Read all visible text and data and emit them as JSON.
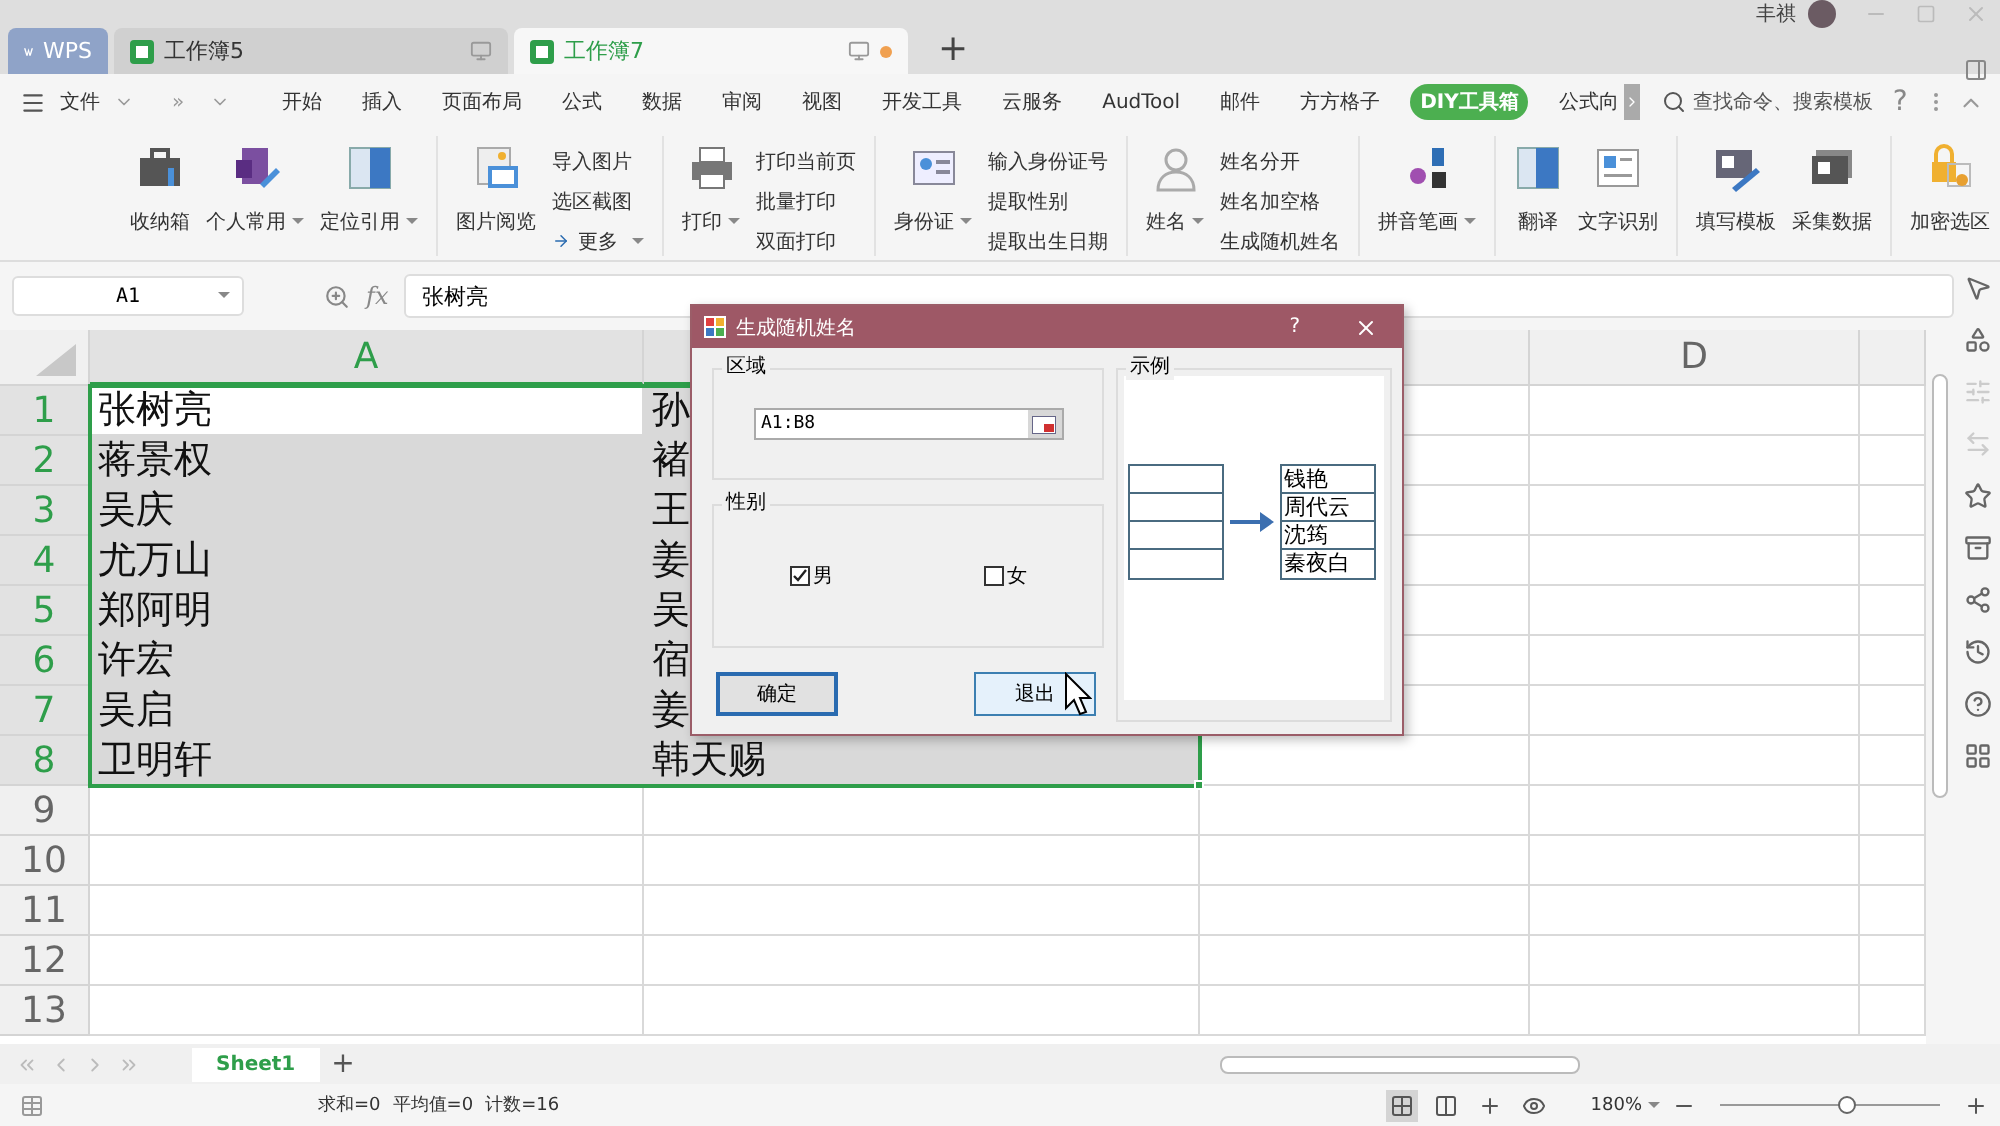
{
  "window": {
    "tabs": [
      {
        "label": "WPS",
        "kind": "home",
        "selected": false,
        "unsaved": false
      },
      {
        "label": "工作簿5",
        "kind": "doc",
        "selected": false,
        "unsaved": false
      },
      {
        "label": "工作簿7",
        "kind": "doc",
        "selected": true,
        "unsaved": true
      }
    ],
    "new_tab": "+",
    "user": "丰祺"
  },
  "menu": {
    "file": "文件",
    "more": "»",
    "tabs": [
      {
        "label": "开始",
        "selected": false
      },
      {
        "label": "插入",
        "selected": false
      },
      {
        "label": "页面布局",
        "selected": false
      },
      {
        "label": "公式",
        "selected": false
      },
      {
        "label": "数据",
        "selected": false
      },
      {
        "label": "审阅",
        "selected": false
      },
      {
        "label": "视图",
        "selected": false
      },
      {
        "label": "开发工具",
        "selected": false
      },
      {
        "label": "云服务",
        "selected": false
      },
      {
        "label": "AudTool",
        "selected": false
      },
      {
        "label": "邮件",
        "selected": false
      },
      {
        "label": "方方格子",
        "selected": false
      },
      {
        "label": "DIY工具箱",
        "selected": true
      },
      {
        "label": "公式向",
        "selected": false
      }
    ],
    "search": {
      "placeholder": "查找命令、搜索模板"
    },
    "help": "?"
  },
  "ribbon": [
    {
      "items": [
        {
          "kind": "large",
          "label": "收纳箱",
          "dropdown": false
        },
        {
          "kind": "large",
          "label": "个人常用",
          "dropdown": true
        },
        {
          "kind": "large",
          "label": "定位引用",
          "dropdown": true
        }
      ]
    },
    {
      "items": [
        {
          "kind": "large",
          "label": "图片阅览",
          "dropdown": false
        },
        {
          "kind": "stack",
          "items": [
            {
              "label": "导入图片",
              "dropdown": false,
              "arrow": false
            },
            {
              "label": "选区截图",
              "dropdown": false,
              "arrow": false
            },
            {
              "label": "更多",
              "dropdown": true,
              "arrow": true
            }
          ]
        }
      ]
    },
    {
      "items": [
        {
          "kind": "large",
          "label": "打印",
          "dropdown": true
        },
        {
          "kind": "stack",
          "items": [
            {
              "label": "打印当前页",
              "dropdown": false,
              "arrow": false
            },
            {
              "label": "批量打印",
              "dropdown": false,
              "arrow": false
            },
            {
              "label": "双面打印",
              "dropdown": false,
              "arrow": false
            }
          ]
        }
      ]
    },
    {
      "items": [
        {
          "kind": "large",
          "label": "身份证",
          "dropdown": true
        },
        {
          "kind": "stack",
          "items": [
            {
              "label": "输入身份证号",
              "dropdown": false,
              "arrow": false
            },
            {
              "label": "提取性别",
              "dropdown": false,
              "arrow": false
            },
            {
              "label": "提取出生日期",
              "dropdown": false,
              "arrow": false
            }
          ]
        }
      ]
    },
    {
      "items": [
        {
          "kind": "large",
          "label": "姓名",
          "dropdown": true
        },
        {
          "kind": "stack",
          "items": [
            {
              "label": "姓名分开",
              "dropdown": false,
              "arrow": false
            },
            {
              "label": "姓名加空格",
              "dropdown": false,
              "arrow": false
            },
            {
              "label": "生成随机姓名",
              "dropdown": false,
              "arrow": false
            }
          ]
        }
      ]
    },
    {
      "items": [
        {
          "kind": "large",
          "label": "拼音笔画",
          "dropdown": true
        }
      ]
    },
    {
      "items": [
        {
          "kind": "large",
          "label": "翻译",
          "dropdown": false
        },
        {
          "kind": "large",
          "label": "文字识别",
          "dropdown": false
        }
      ]
    },
    {
      "items": [
        {
          "kind": "large",
          "label": "填写模板",
          "dropdown": false
        },
        {
          "kind": "large",
          "label": "采集数据",
          "dropdown": false
        }
      ]
    },
    {
      "items": [
        {
          "kind": "large",
          "label": "加密选区",
          "dropdown": false
        }
      ]
    }
  ],
  "formula_bar": {
    "cell_ref": "A1",
    "fx": "fx",
    "value": "张树亮"
  },
  "sheet": {
    "columns": [
      {
        "label": "A",
        "selected": true
      },
      {
        "selected": true
      },
      {
        "selected": false
      },
      {
        "label": "D",
        "selected": false
      },
      {
        "selected": false
      }
    ],
    "rows": [
      {
        "number": "1",
        "selected": true,
        "cells": [
          {
            "text": "张树亮",
            "selected": true,
            "active": true
          },
          {
            "text": "孙",
            "selected": true,
            "active": false
          }
        ]
      },
      {
        "number": "2",
        "selected": true,
        "cells": [
          {
            "text": "蒋景权",
            "selected": true,
            "active": false
          },
          {
            "text": "褚",
            "selected": true,
            "active": false
          }
        ]
      },
      {
        "number": "3",
        "selected": true,
        "cells": [
          {
            "text": "吴庆",
            "selected": true,
            "active": false
          },
          {
            "text": "王",
            "selected": true,
            "active": false
          }
        ]
      },
      {
        "number": "4",
        "selected": true,
        "cells": [
          {
            "text": "尤万山",
            "selected": true,
            "active": false
          },
          {
            "text": "姜",
            "selected": true,
            "active": false
          }
        ]
      },
      {
        "number": "5",
        "selected": true,
        "cells": [
          {
            "text": "郑阿明",
            "selected": true,
            "active": false
          },
          {
            "text": "吴",
            "selected": true,
            "active": false
          }
        ]
      },
      {
        "number": "6",
        "selected": true,
        "cells": [
          {
            "text": "许宏",
            "selected": true,
            "active": false
          },
          {
            "text": "宿",
            "selected": true,
            "active": false
          }
        ]
      },
      {
        "number": "7",
        "selected": true,
        "cells": [
          {
            "text": "吴启",
            "selected": true,
            "active": false
          },
          {
            "text": "姜",
            "selected": true,
            "active": false
          }
        ]
      },
      {
        "number": "8",
        "selected": true,
        "cells": [
          {
            "text": "卫明轩",
            "selected": true,
            "active": false
          },
          {
            "text": "韩天赐",
            "selected": true,
            "active": false
          }
        ]
      },
      {
        "number": "9",
        "selected": false
      },
      {
        "number": "10",
        "selected": false
      },
      {
        "number": "11",
        "selected": false
      },
      {
        "number": "12",
        "selected": false
      },
      {
        "number": "13",
        "selected": false
      }
    ]
  },
  "sheet_tabs": {
    "tabs": [
      {
        "label": "Sheet1",
        "selected": true
      }
    ],
    "add": "+"
  },
  "status_bar": {
    "stats": [
      "求和=0",
      "平均值=0",
      "计数=16"
    ],
    "zoom": "180%",
    "zoom_slider": {
      "level": 0.57
    }
  },
  "dialog": {
    "title": "生成随机姓名",
    "help": "?",
    "range": {
      "label": "区域",
      "value": "A1:B8"
    },
    "gender": {
      "label": "性别",
      "options": [
        {
          "label": "男",
          "checked": true
        },
        {
          "label": "女",
          "checked": false
        }
      ]
    },
    "buttons": [
      {
        "label": "确定",
        "hovered": false
      },
      {
        "label": "退出",
        "hovered": true
      }
    ],
    "example": {
      "label": "示例",
      "names": [
        "钱艳",
        "周代云",
        "沈筠",
        "秦夜白"
      ]
    }
  }
}
